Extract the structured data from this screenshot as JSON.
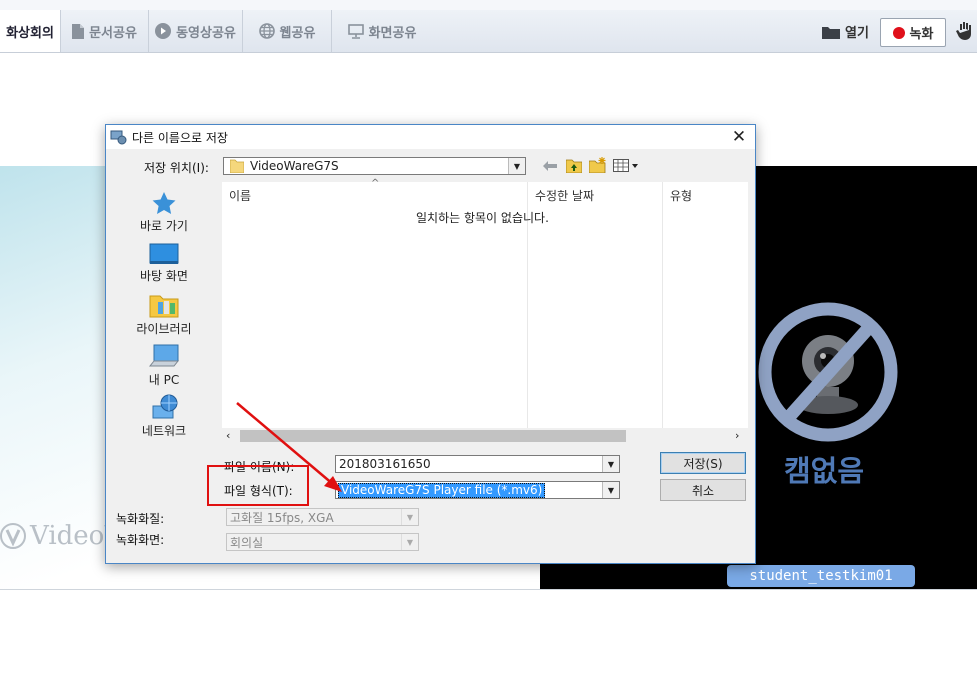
{
  "toolbar": {
    "tabs": [
      {
        "label": "화상회의",
        "icon": "video-conference",
        "active": true
      },
      {
        "label": "문서공유",
        "icon": "document-icon",
        "active": false
      },
      {
        "label": "동영상공유",
        "icon": "play-icon",
        "active": false
      },
      {
        "label": "웹공유",
        "icon": "globe-icon",
        "active": false
      },
      {
        "label": "화면공유",
        "icon": "monitor-icon",
        "active": false
      }
    ],
    "open_label": "열기",
    "record_label": "녹화"
  },
  "stage": {
    "logo_text": "VideoW",
    "no_cam_label": "캠없음",
    "user_badge": "student_testkim01"
  },
  "dialog": {
    "title": "다른 이름으로 저장",
    "save_in_label": "저장 위치(I):",
    "save_in_value": "VideoWareG7S",
    "places": [
      {
        "label": "바로 가기",
        "icon": "quick-access-icon"
      },
      {
        "label": "바탕 화면",
        "icon": "desktop-icon"
      },
      {
        "label": "라이브러리",
        "icon": "library-icon"
      },
      {
        "label": "내 PC",
        "icon": "this-pc-icon"
      },
      {
        "label": "네트워크",
        "icon": "network-icon"
      }
    ],
    "columns": {
      "name": "이름",
      "modified": "수정한 날짜",
      "type": "유형"
    },
    "empty_message": "일치하는 항목이 없습니다.",
    "filename_label": "파일 이름(N):",
    "filename_value": "201803161650",
    "filetype_label": "파일 형식(T):",
    "filetype_value": "VideoWareG7S Player file (*.mv6)",
    "quality_label": "녹화화질:",
    "quality_value": "고화질 15fps, XGA",
    "screen_label": "녹화화면:",
    "screen_value": "회의실",
    "save_button": "저장(S)",
    "cancel_button": "취소"
  },
  "colors": {
    "annotation": "#e01010",
    "accent": "#3399ff",
    "badge": "#7aa9e6",
    "record_dot": "#e0101a"
  }
}
